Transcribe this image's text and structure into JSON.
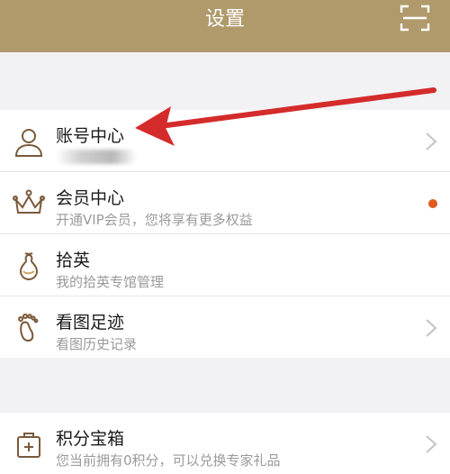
{
  "header": {
    "title": "设置",
    "scan_icon": "scan-icon"
  },
  "menu_group_1": [
    {
      "key": "account",
      "icon": "user-icon",
      "title": "账号中心",
      "subtitle": "",
      "trailing": "chevron"
    },
    {
      "key": "vip",
      "icon": "crown-icon",
      "title": "会员中心",
      "subtitle": "开通VIP会员，您将享有更多权益",
      "trailing": "dot"
    },
    {
      "key": "shiying",
      "icon": "gourd-icon",
      "title": "拾英",
      "subtitle": "我的拾英专馆管理",
      "trailing": "none"
    },
    {
      "key": "history",
      "icon": "footprint-icon",
      "title": "看图足迹",
      "subtitle": "看图历史记录",
      "trailing": "chevron"
    }
  ],
  "menu_group_2": [
    {
      "key": "points",
      "icon": "medkit-icon",
      "title": "积分宝箱",
      "subtitle": "您当前拥有0积分，可以兑换专家礼品",
      "trailing": "chevron"
    }
  ],
  "colors": {
    "header": "#b09a6c",
    "accent_dot": "#e05a1e",
    "arrow": "#d42b2b",
    "icon": "#7a5a3a"
  }
}
